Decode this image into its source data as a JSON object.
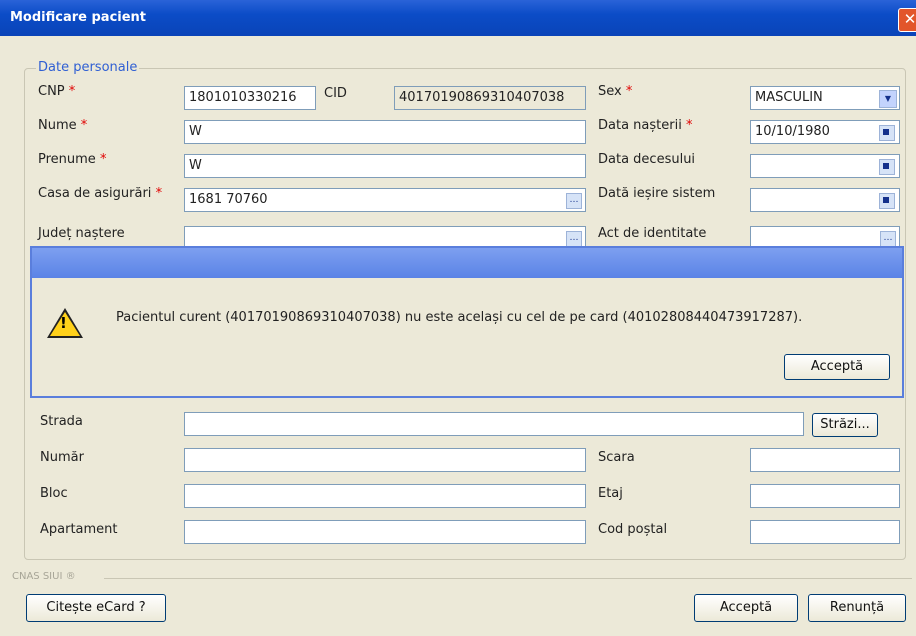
{
  "window": {
    "title": "Modificare pacient"
  },
  "personal": {
    "legend": "Date personale",
    "cnp_label": "CNP",
    "cnp_value": "1801010330216",
    "cid_label": "CID",
    "cid_value": "40170190869310407038",
    "sex_label": "Sex",
    "sex_value": "MASCULIN",
    "nume_label": "Nume",
    "nume_value": "W",
    "data_nasterii_label": "Data nașterii",
    "data_nasterii_value": "10/10/1980",
    "prenume_label": "Prenume",
    "prenume_value": "W",
    "data_decesului_label": "Data decesului",
    "casa_label": "Casa de asigurări",
    "casa_value": "1681 70760",
    "data_iesire_label": "Dată ieșire sistem",
    "judet_label": "Județ naștere",
    "act_label": "Act de identitate",
    "required_mark": "*"
  },
  "dialog": {
    "message": "Pacientul curent (40170190869310407038) nu este același cu cel de pe card (40102808440473917287).",
    "accept_label": "Acceptă"
  },
  "address": {
    "strada_label": "Strada",
    "strazi_button": "Străzi...",
    "numar_label": "Număr",
    "scara_label": "Scara",
    "bloc_label": "Bloc",
    "etaj_label": "Etaj",
    "apartament_label": "Apartament",
    "cod_postal_label": "Cod poștal"
  },
  "footer": {
    "cnas_label": "CNAS SIUI ®",
    "citeste_button": "Citește eCard ?",
    "accept_button": "Acceptă",
    "renunta_button": "Renunță"
  }
}
